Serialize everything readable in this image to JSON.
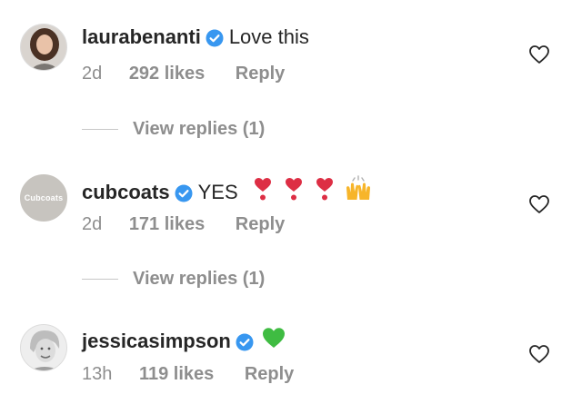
{
  "comments": [
    {
      "username": "laurabenanti",
      "text": "Love this",
      "time": "2d",
      "likes": "292 likes",
      "reply_label": "Reply",
      "view_replies": "View replies (1)"
    },
    {
      "username": "cubcoats",
      "avatar_text": "Cubcoats",
      "text": "YES",
      "time": "2d",
      "likes": "171 likes",
      "reply_label": "Reply",
      "view_replies": "View replies (1)",
      "emojis": [
        "heart-exclamation",
        "heart-exclamation",
        "heart-exclamation",
        "raising-hands"
      ]
    },
    {
      "username": "jessicasimpson",
      "text": "",
      "time": "13h",
      "likes": "119 likes",
      "reply_label": "Reply",
      "emojis": [
        "green-heart"
      ]
    }
  ],
  "icons": {
    "verified_badge": "verified-badge-icon",
    "like": "heart-outline-icon"
  },
  "colors": {
    "verified": "#3897f0",
    "muted": "#8e8e8e",
    "text": "#262626",
    "emoji_red": "#dd2e44",
    "emoji_green": "#3fbc42"
  }
}
